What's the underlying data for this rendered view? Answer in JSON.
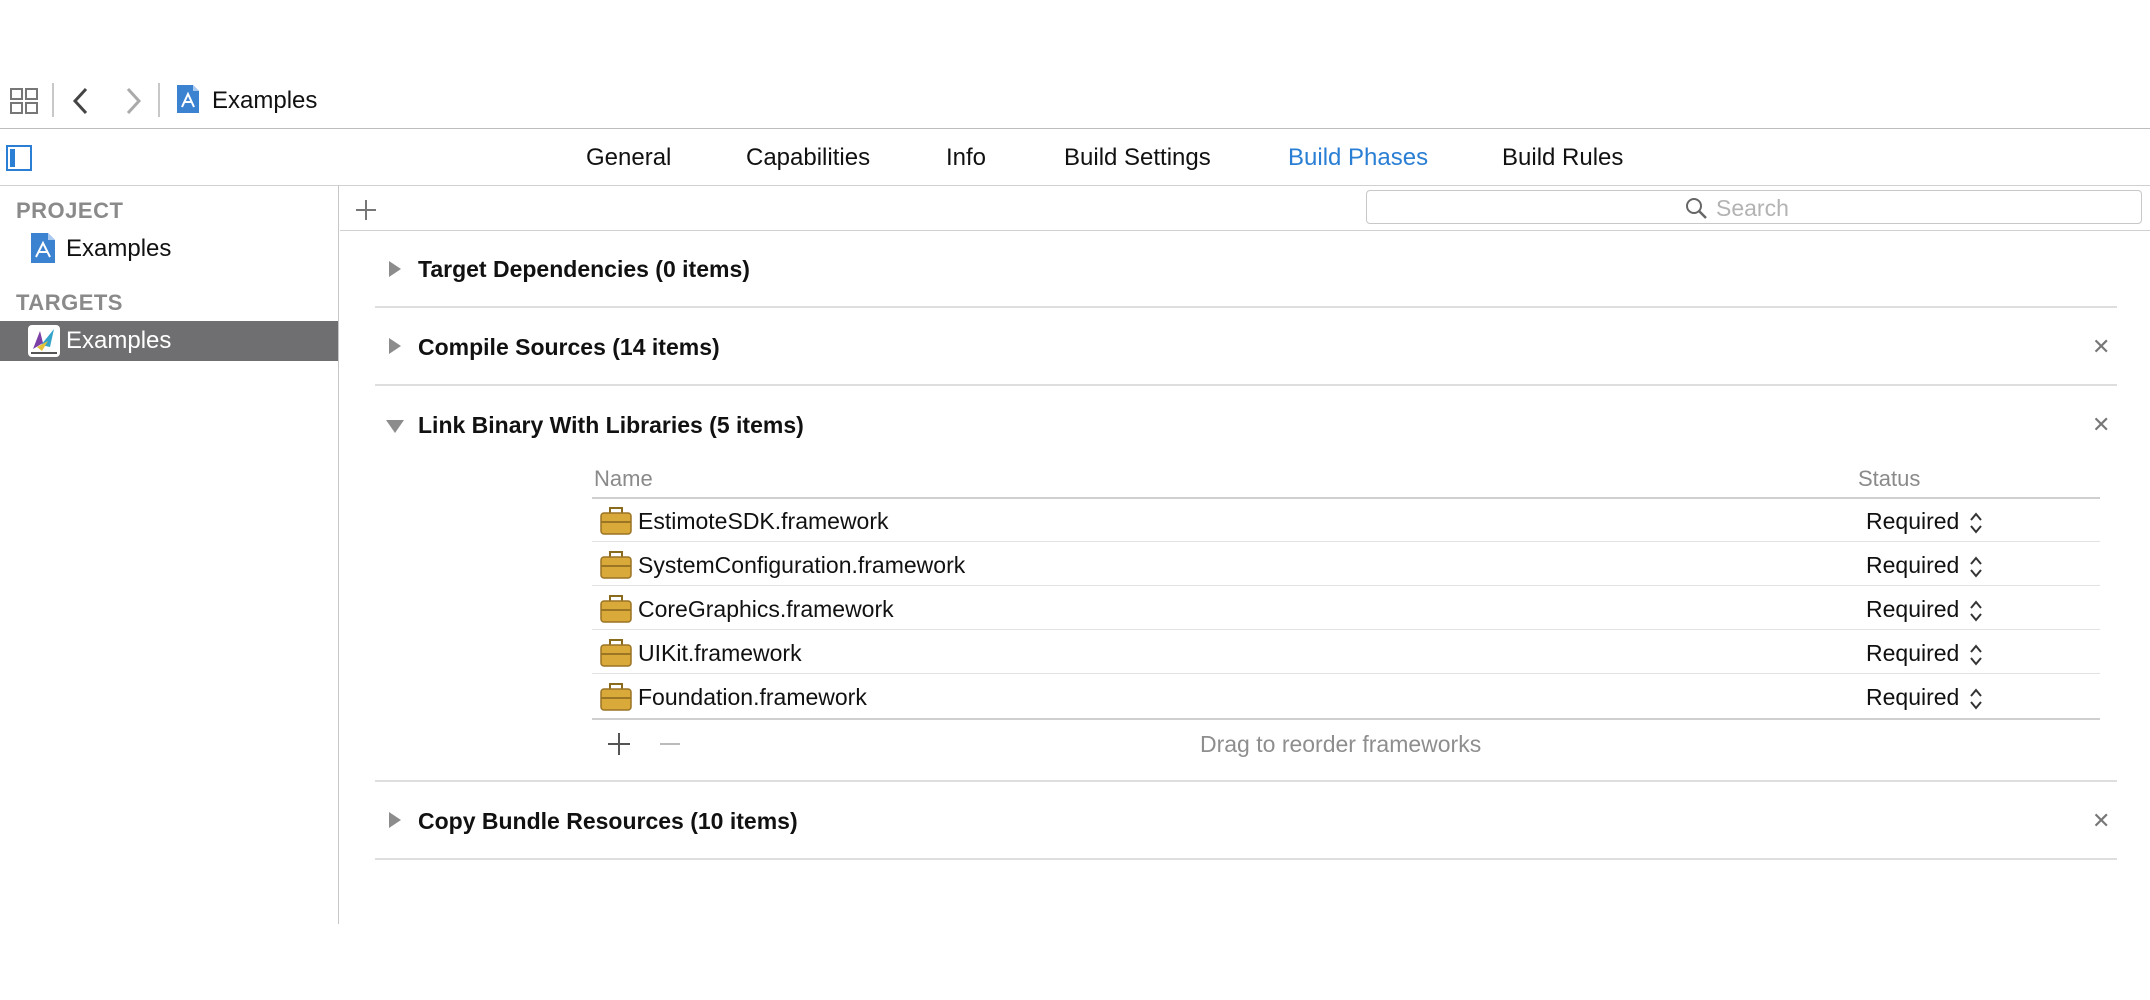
{
  "toolbar": {
    "title": "Examples",
    "icons": [
      "grid-icon",
      "back-icon",
      "forward-icon",
      "project-file-icon"
    ]
  },
  "tabs": [
    {
      "label": "General"
    },
    {
      "label": "Capabilities"
    },
    {
      "label": "Info"
    },
    {
      "label": "Build Settings"
    },
    {
      "label": "Build Phases",
      "active": true
    },
    {
      "label": "Build Rules"
    }
  ],
  "sidebar": {
    "project_header": "PROJECT",
    "project_item": "Examples",
    "targets_header": "TARGETS",
    "target_item": "Examples",
    "selected_bg": "#6f6f71"
  },
  "filter": {
    "placeholder": "Search"
  },
  "phases": {
    "target_dependencies": "Target Dependencies (0 items)",
    "compile_sources": "Compile Sources (14 items)",
    "link_binary": "Link Binary With Libraries (5 items)",
    "copy_bundle": "Copy Bundle Resources (10 items)"
  },
  "libraries": {
    "col_name": "Name",
    "col_status": "Status",
    "rows": [
      {
        "name": "EstimoteSDK.framework",
        "status": "Required"
      },
      {
        "name": "SystemConfiguration.framework",
        "status": "Required"
      },
      {
        "name": "CoreGraphics.framework",
        "status": "Required"
      },
      {
        "name": "UIKit.framework",
        "status": "Required"
      },
      {
        "name": "Foundation.framework",
        "status": "Required"
      }
    ],
    "hint": "Drag to reorder frameworks"
  },
  "colors": {
    "accent": "#2a7fd4",
    "framework_icon": "#d9a93a"
  }
}
